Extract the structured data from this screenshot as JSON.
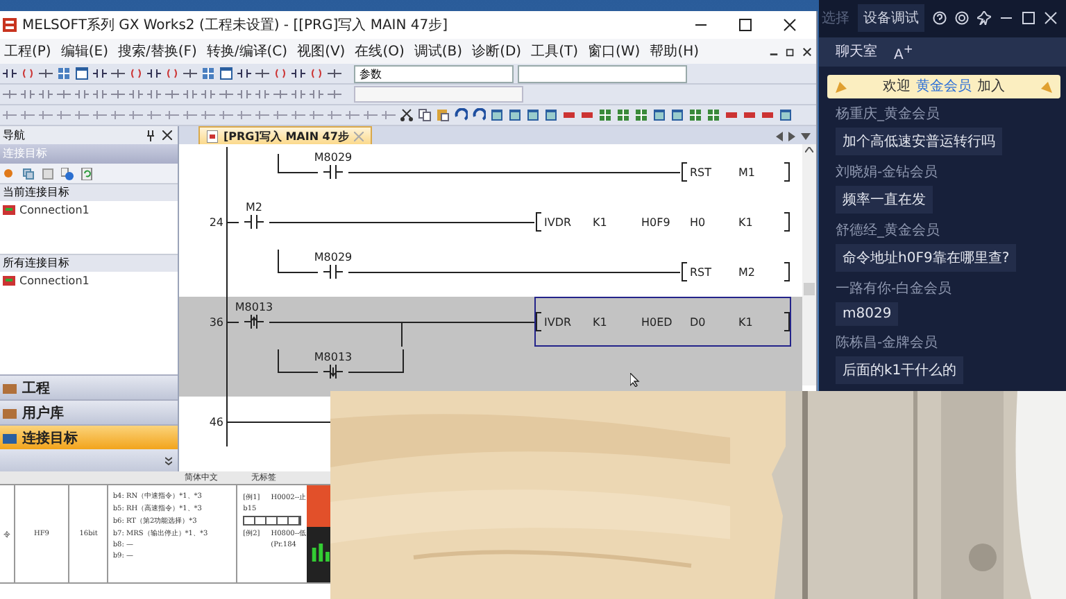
{
  "window": {
    "title": "MELSOFT系列 GX Works2 (工程未设置) - [[PRG]写入 MAIN 47步]"
  },
  "menus": [
    "工程(P)",
    "编辑(E)",
    "搜索/替换(F)",
    "转换/编译(C)",
    "视图(V)",
    "在线(O)",
    "调试(B)",
    "诊断(D)",
    "工具(T)",
    "窗口(W)",
    "帮助(H)"
  ],
  "toolbar": {
    "search_value": "参数"
  },
  "navigation": {
    "title": "导航",
    "section": "连接目标",
    "current_header": "当前连接目标",
    "current_items": [
      "Connection1"
    ],
    "all_header": "所有连接目标",
    "all_items": [
      "Connection1"
    ],
    "tabs": [
      {
        "label": "工程",
        "selected": false
      },
      {
        "label": "用户库",
        "selected": false
      },
      {
        "label": "连接目标",
        "selected": true
      }
    ]
  },
  "editor": {
    "tab": "[PRG]写入 MAIN 47步",
    "lines": [
      {
        "contact": "M8029",
        "kind": "normal",
        "branch": true,
        "highlighted": false,
        "selected": false,
        "operands": [
          "RST",
          "M1"
        ]
      },
      {
        "step": "24",
        "contact": "M2",
        "kind": "normal",
        "branch": false,
        "highlighted": false,
        "selected": false,
        "operands": [
          "IVDR",
          "K1",
          "H0F9",
          "H0",
          "K1"
        ]
      },
      {
        "contact": "M8029",
        "kind": "normal",
        "branch": true,
        "highlighted": false,
        "selected": false,
        "operands": [
          "RST",
          "M2"
        ]
      },
      {
        "step": "36",
        "contact": "M8013",
        "kind": "rising",
        "branch": false,
        "highlighted": true,
        "selected": true,
        "operands": [
          "IVDR",
          "K1",
          "H0ED",
          "D0",
          "K1"
        ]
      },
      {
        "contact": "M8013",
        "kind": "falling",
        "branch": true,
        "highlighted": true
      },
      {
        "step": "46",
        "kind": "empty",
        "highlighted": false
      }
    ]
  },
  "document": {
    "status": [
      "简体中文",
      "无标签"
    ],
    "cells": [
      "令",
      "HF9",
      "16bit"
    ],
    "bits": [
      "b4: RN（中速指令）*1、*3",
      "b5: RH（高速指令）*1、*3",
      "b6: RT（第2功能选择）*3",
      "b7: MRS（输出停止）*1、*3",
      "b8: —",
      "b9: —"
    ],
    "examples": [
      "[例1]",
      "H0002--止",
      "b15",
      "[例2]",
      "H0800--低",
      "(Pr.184"
    ]
  },
  "chat": {
    "top_left": "选择",
    "device_button": "设备调试",
    "title": "聊天室",
    "font_button": "A$^{+}$",
    "welcome": {
      "prefix": "欢迎",
      "member": "黄金会员",
      "suffix": "加入"
    },
    "messages": [
      {
        "user": "杨重庆_黄金会员",
        "text": "加个高低速安普运转行吗"
      },
      {
        "user": "刘晓娟-金钻会员",
        "text": "频率一直在发"
      },
      {
        "user": "舒德经_黄金会员",
        "text": "命令地址h0F9靠在哪里查?"
      },
      {
        "user": "一路有你-白金会员",
        "text": "m8029"
      },
      {
        "user": "陈栋昌-金牌会员",
        "text": "后面的k1干什么的"
      }
    ]
  }
}
